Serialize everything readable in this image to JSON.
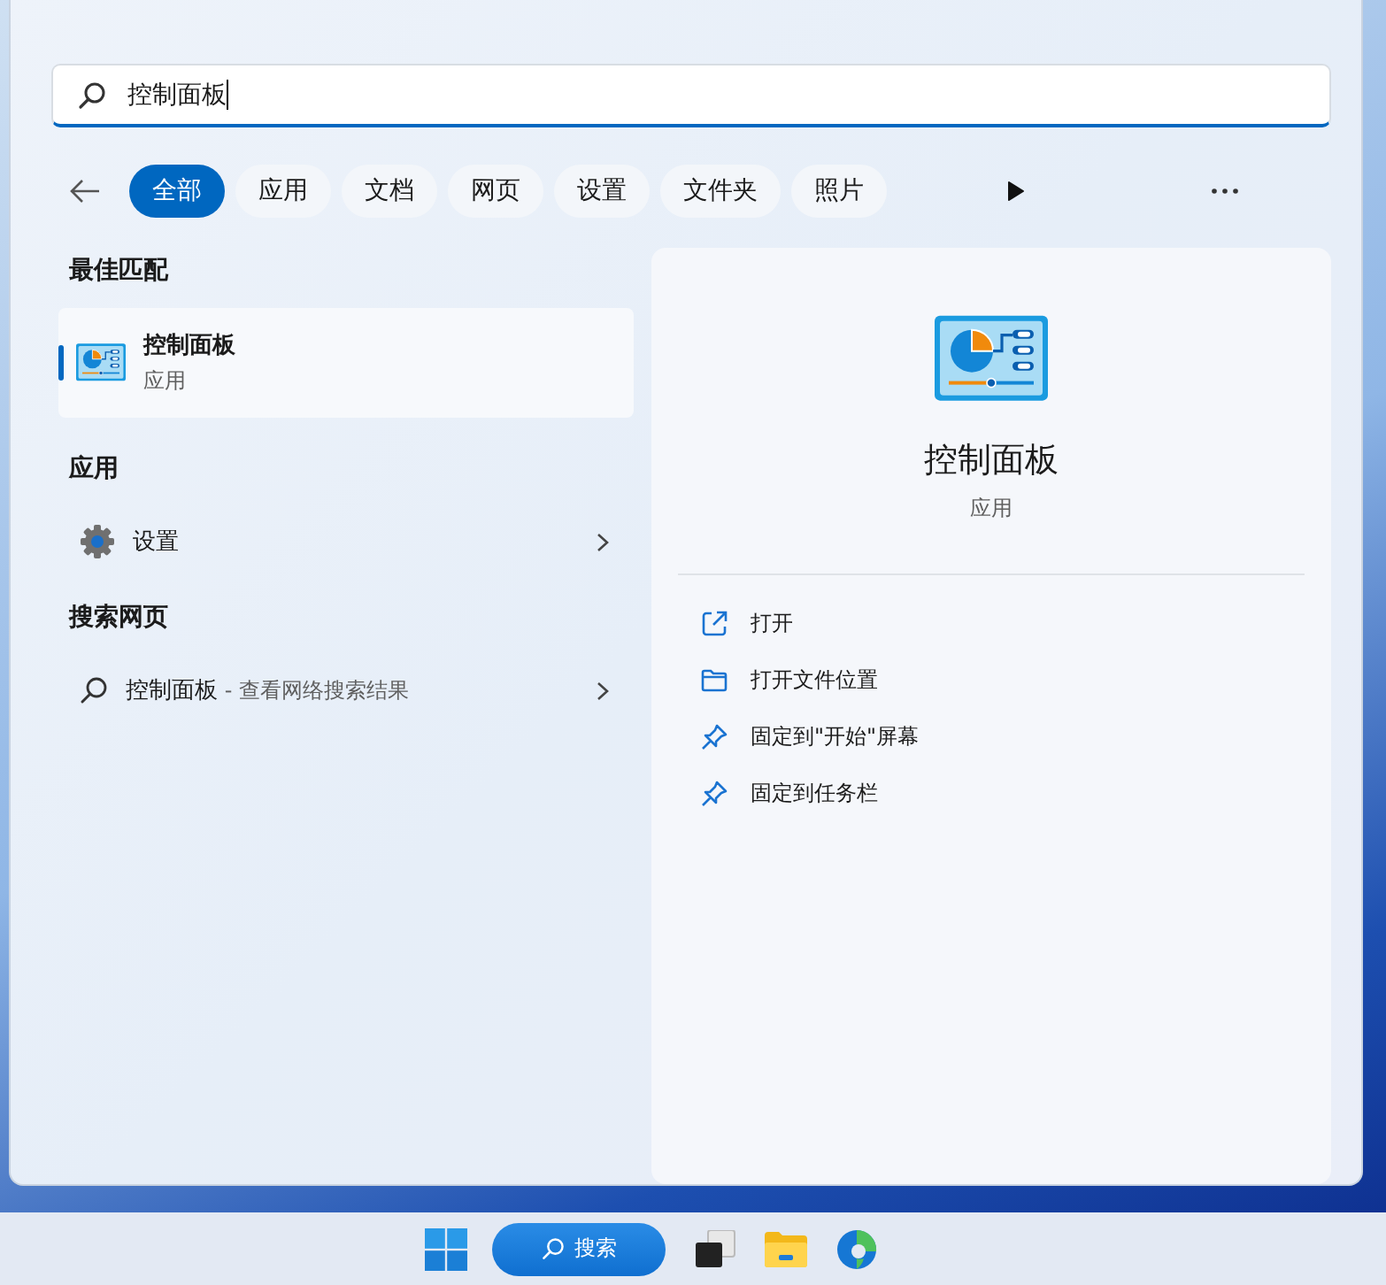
{
  "search": {
    "value": "控制面板"
  },
  "filters": [
    {
      "label": "全部",
      "selected": true
    },
    {
      "label": "应用",
      "selected": false
    },
    {
      "label": "文档",
      "selected": false
    },
    {
      "label": "网页",
      "selected": false
    },
    {
      "label": "设置",
      "selected": false
    },
    {
      "label": "文件夹",
      "selected": false
    },
    {
      "label": "照片",
      "selected": false
    }
  ],
  "best_match": {
    "heading": "最佳匹配",
    "item": {
      "title": "控制面板",
      "subtitle": "应用",
      "selected": true
    }
  },
  "apps": {
    "heading": "应用",
    "items": [
      {
        "label": "设置"
      }
    ]
  },
  "web": {
    "heading": "搜索网页",
    "items": [
      {
        "query": "控制面板",
        "hint": " - 查看网络搜索结果"
      }
    ]
  },
  "detail": {
    "title": "控制面板",
    "subtitle": "应用",
    "actions": [
      {
        "kind": "open",
        "label": "打开"
      },
      {
        "kind": "folder",
        "label": "打开文件位置"
      },
      {
        "kind": "pin",
        "label": "固定到\"开始\"屏幕"
      },
      {
        "kind": "pin",
        "label": "固定到任务栏"
      }
    ]
  },
  "taskbar": {
    "search_label": "搜索"
  }
}
